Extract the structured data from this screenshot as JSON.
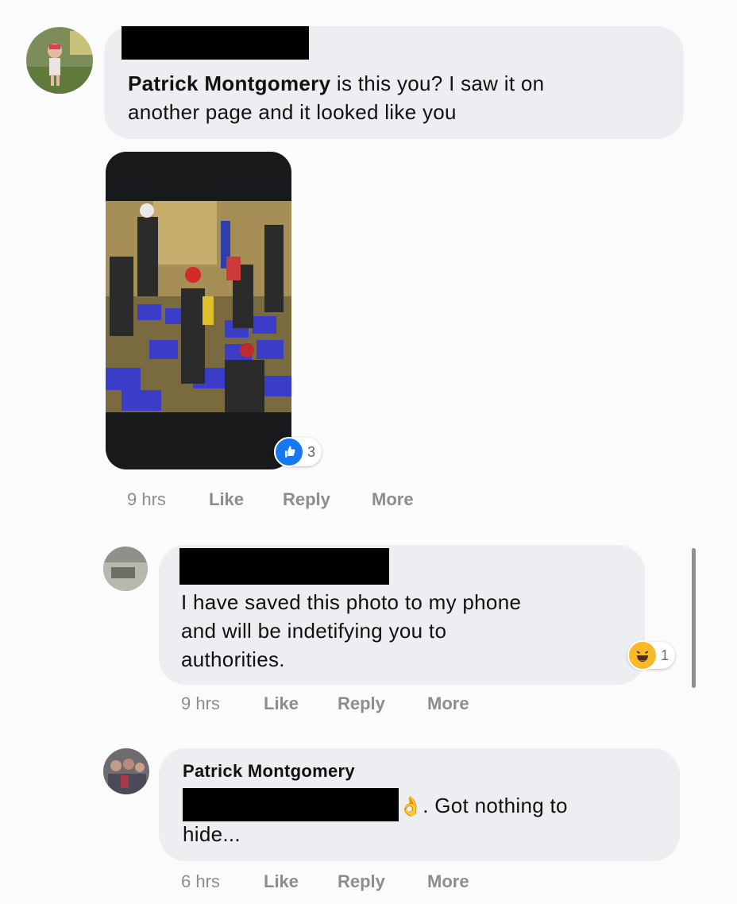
{
  "comments": [
    {
      "author_tag": "Patrick Montgomery",
      "text": " is this you? I saw it on another page and it looked like you",
      "line1": " is this you? I saw it on",
      "line2": "another page and it looked like you",
      "reaction_count": "3",
      "reaction_icon": "like-icon",
      "time": "9 hrs",
      "like": "Like",
      "reply": "Reply",
      "more": "More"
    },
    {
      "line1": "I have saved this photo to my phone",
      "line2": "and will be indetifying you to",
      "line3": "authorities.",
      "reaction_count": "1",
      "reaction_icon": "haha-icon",
      "time": "9 hrs",
      "like": "Like",
      "reply": "Reply",
      "more": "More"
    },
    {
      "author": "Patrick Montgomery",
      "emoji": "👌",
      "line1_tail": ". Got nothing to",
      "line2": "hide...",
      "time": "6 hrs",
      "like": "Like",
      "reply": "Reply",
      "more": "More"
    }
  ],
  "colors": {
    "bubble": "#eceef1",
    "like_blue": "#1877f2",
    "haha_yellow": "#f7b928",
    "meta_gray": "#8a8d91"
  }
}
